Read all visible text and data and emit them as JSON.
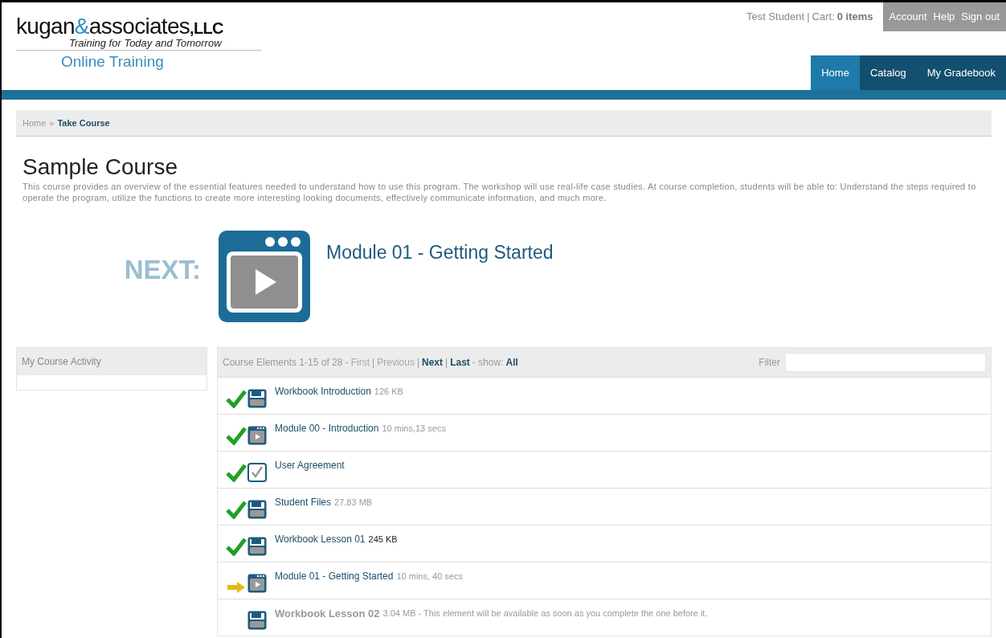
{
  "logo": {
    "parts": [
      "kugan",
      "&",
      "associates",
      ",LLC"
    ],
    "tagline": "Training for Today and Tomorrow",
    "subtitle": "Online Training"
  },
  "user_bar": {
    "user": "Test Student",
    "separator": "|",
    "cart_label": "Cart:",
    "cart_count": "0 items",
    "links": [
      "Account",
      "Help",
      "Sign out"
    ]
  },
  "nav": [
    {
      "label": "Home",
      "selected": true
    },
    {
      "label": "Catalog",
      "selected": false
    },
    {
      "label": "My Gradebook",
      "selected": false
    }
  ],
  "breadcrumb": [
    "Home",
    "»",
    "Take Course"
  ],
  "course": {
    "title": "Sample Course",
    "description": "This course provides an overview of the essential features needed to understand how to use this program. The workshop will use real-life case studies. At course completion, students will be able to: Understand the steps required to operate the program, utilize the functions to create more interesting looking documents, effectively communicate information, and much more."
  },
  "next": {
    "label": "NEXT:",
    "title": "Module 01 - Getting Started"
  },
  "activity": {
    "title": "My Course Activity"
  },
  "elements": {
    "separator": "|",
    "summary": "Course Elements 1-15 of 28 -",
    "pager": [
      {
        "label": "First",
        "disabled": true
      },
      {
        "label": "Previous",
        "disabled": true
      },
      {
        "label": "Next",
        "disabled": false
      },
      {
        "label": "Last",
        "disabled": false
      }
    ],
    "show_label": "- show:",
    "show_value": "All",
    "filter_label": "Filter",
    "rows": [
      {
        "completed": true,
        "current": false,
        "kind": "document",
        "title": "Workbook Introduction",
        "meta": "126 KB"
      },
      {
        "completed": true,
        "current": false,
        "kind": "video",
        "title": "Module 00 - Introduction",
        "meta": "10 mins,13 secs"
      },
      {
        "completed": true,
        "current": false,
        "kind": "agreement",
        "title": "User Agreement"
      },
      {
        "completed": true,
        "current": false,
        "kind": "document",
        "title": "Student Files",
        "meta": "27.83 MB"
      },
      {
        "completed": true,
        "current": false,
        "kind": "document",
        "title": "Workbook Lesson 01",
        "meta": "245 KB"
      },
      {
        "completed": false,
        "current": true,
        "kind": "video",
        "title": "Module 01 - Getting Started",
        "meta": "10 mins, 40 secs"
      },
      {
        "completed": false,
        "current": false,
        "kind": "document",
        "title": "Workbook Lesson 02",
        "meta": "3.04 MB - This element will be available as soon as you complete the one before it."
      }
    ]
  }
}
